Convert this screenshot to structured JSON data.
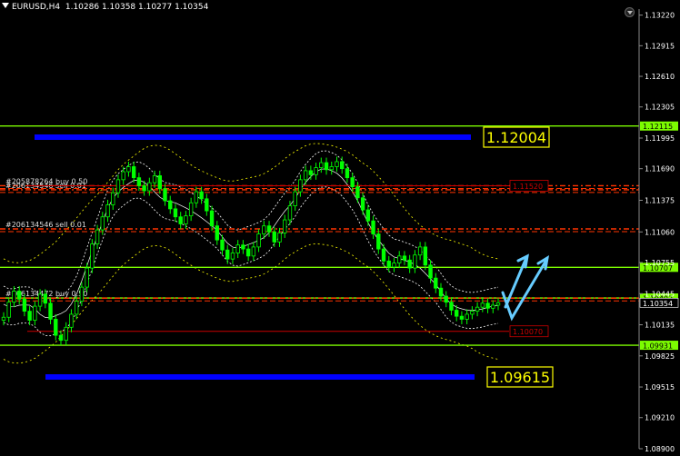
{
  "header": {
    "symbol_timeframe": "EURUSD,H4",
    "ohlc": "1.10286 1.10358 1.10277 1.10354"
  },
  "colors": {
    "background": "#000000",
    "candle_up": "#00ff00",
    "level_line": "#7cfc00",
    "zone_bar": "#0000ff",
    "label_box_border": "#ffff00",
    "label_box_text": "#ffff00",
    "order_line": "#ff3300",
    "arrow": "#66ccff",
    "ma_line": "#ffff00",
    "axis_text": "#ffffff"
  },
  "chart_data": {
    "type": "candlestick",
    "symbol": "EURUSD",
    "timeframe": "H4",
    "ylim": [
      1.089,
      1.1328
    ],
    "y_ticks": [
      "1.13220",
      "1.12915",
      "1.12610",
      "1.12305",
      "1.11995",
      "1.11690",
      "1.11375",
      "1.11060",
      "1.10755",
      "1.10445",
      "1.10135",
      "1.09825",
      "1.09515",
      "1.09210",
      "1.08900"
    ],
    "price_marks": [
      {
        "label": "1.12115",
        "value": 1.12115
      },
      {
        "label": "1.10707",
        "value": 1.10707
      },
      {
        "label": "1.10402",
        "value": 1.10402
      },
      {
        "label": "1.10354",
        "value": 1.10354
      },
      {
        "label": "1.09931",
        "value": 1.09931
      }
    ],
    "horizontal_levels": [
      1.12115,
      1.10707,
      1.10402,
      1.09931
    ],
    "zones": [
      {
        "label": "1.12004",
        "value": 1.12004
      },
      {
        "label": "1.09615",
        "value": 1.09615
      }
    ],
    "order_lines": [
      {
        "label": "#205878264 buy 0.50",
        "value": 1.1152
      },
      {
        "label": "#206134546 sell 0.01",
        "value": 1.1148
      },
      {
        "label": "#206134546 sell 0.01",
        "value": 1.1109
      },
      {
        "label": "#206134472 buy 0.50",
        "value": 1.104
      }
    ],
    "order_price_tags": [
      {
        "label": "1.11520",
        "value": 1.1152
      },
      {
        "label": "1.10070",
        "value": 1.1007
      }
    ],
    "close_series": [
      1.1021,
      1.1036,
      1.1047,
      1.1039,
      1.1027,
      1.1018,
      1.1032,
      1.1044,
      1.1035,
      1.1019,
      1.1003,
      1.0998,
      1.1011,
      1.1024,
      1.1037,
      1.1051,
      1.107,
      1.1094,
      1.1108,
      1.1121,
      1.1133,
      1.1145,
      1.1158,
      1.1166,
      1.1171,
      1.116,
      1.1152,
      1.1147,
      1.1155,
      1.1162,
      1.1149,
      1.1137,
      1.1129,
      1.1121,
      1.1114,
      1.1122,
      1.1135,
      1.1146,
      1.1139,
      1.1127,
      1.1112,
      1.1098,
      1.1088,
      1.1079,
      1.1085,
      1.1093,
      1.1089,
      1.1082,
      1.1091,
      1.1104,
      1.1112,
      1.1106,
      1.1096,
      1.1105,
      1.1118,
      1.1132,
      1.1146,
      1.1158,
      1.1167,
      1.1163,
      1.117,
      1.1175,
      1.1168,
      1.1171,
      1.1176,
      1.1169,
      1.116,
      1.1151,
      1.114,
      1.1128,
      1.1117,
      1.1104,
      1.1089,
      1.1077,
      1.1071,
      1.1075,
      1.1082,
      1.1078,
      1.107,
      1.1083,
      1.1091,
      1.1073,
      1.106,
      1.105,
      1.1042,
      1.1036,
      1.1028,
      1.1022,
      1.1019,
      1.1024,
      1.1027,
      1.1031,
      1.1035,
      1.103,
      1.1033,
      1.10354
    ]
  }
}
